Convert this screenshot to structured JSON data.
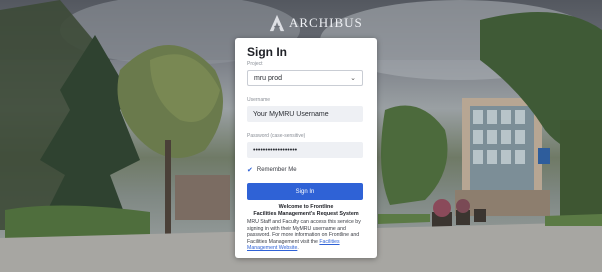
{
  "branding": {
    "logo_text": "ARCHIBUS"
  },
  "signin": {
    "title": "Sign In",
    "project_label": "Project",
    "project_value": "mru prod",
    "username_label": "Username",
    "username_value": "Your MyMRU Username",
    "password_label": "Password (case-sensitive)",
    "password_value": "••••••••••••••••••",
    "remember_label": "Remember Me",
    "remember_checked": true,
    "button_label": "Sign In",
    "welcome_line1": "Welcome to Frontline",
    "welcome_line2": "Facilities Management's Request System",
    "description": "MRU Staff and Faculty can access this service by signing in with their MyMRU username and password. For more information on Frontline and Facilities Management visit the ",
    "link_text": "Facilities Management Website",
    "link_suffix": "."
  },
  "colors": {
    "accent": "#2f62d6",
    "card_bg": "#ffffff",
    "field_bg": "#eef0f4"
  }
}
